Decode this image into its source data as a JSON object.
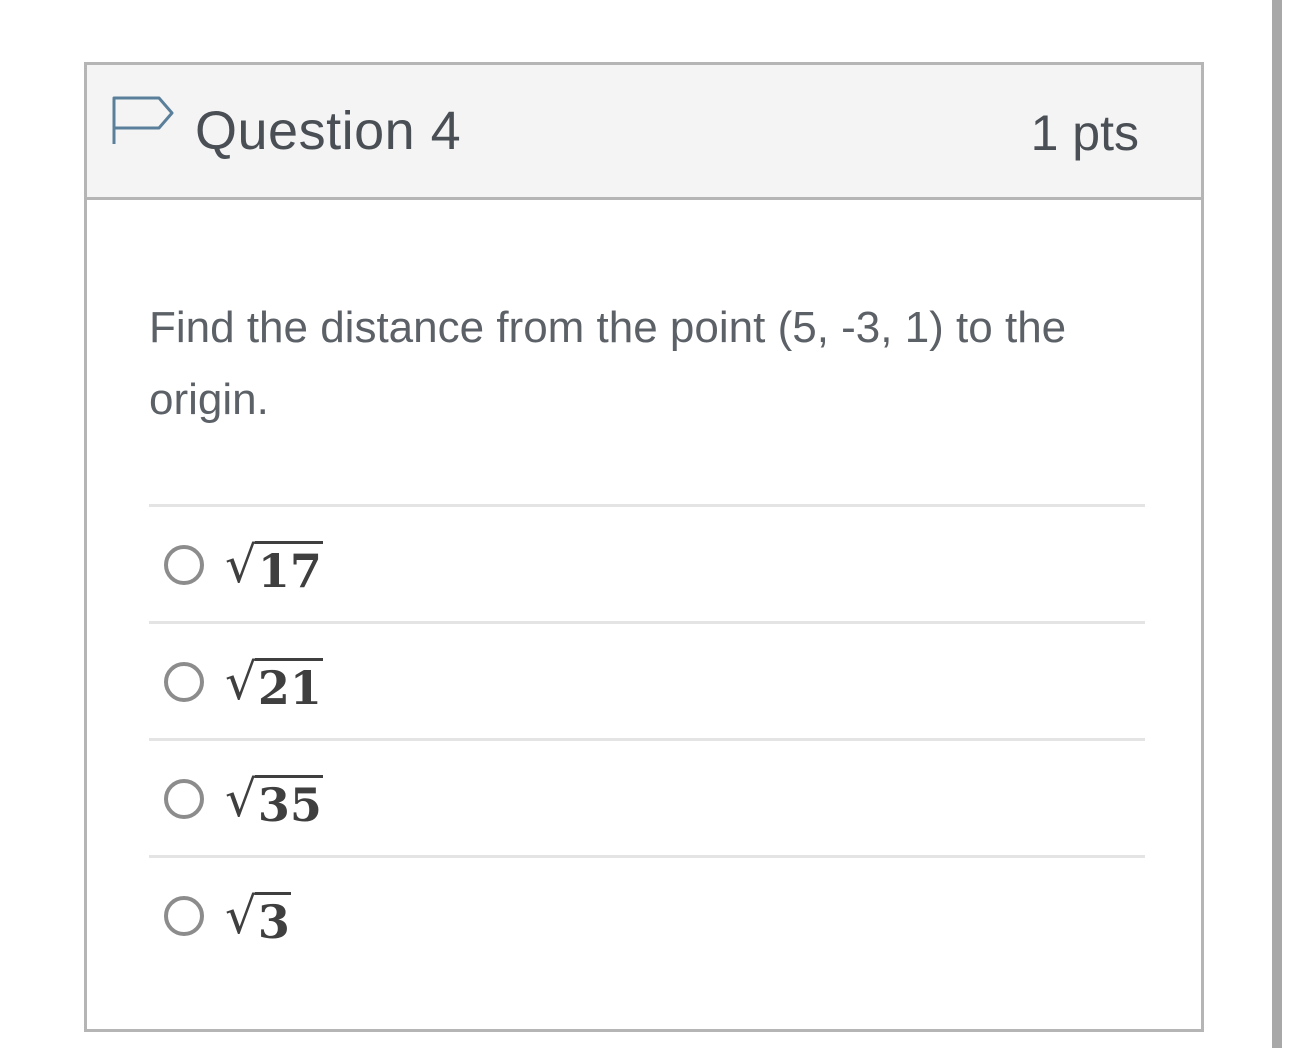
{
  "question": {
    "title": "Question 4",
    "points": "1 pts",
    "text": "Find the distance from the point (5, -3, 1) to the origin.",
    "flag_icon": "flag-outline-icon"
  },
  "answers": [
    {
      "symbol": "√",
      "radicand": "17"
    },
    {
      "symbol": "√",
      "radicand": "21"
    },
    {
      "symbol": "√",
      "radicand": "35"
    },
    {
      "symbol": "√",
      "radicand": "3"
    }
  ],
  "colors": {
    "header_bg": "#f4f4f4",
    "border": "#b5b5b5",
    "text": "#4a4f55",
    "flag": "#5a7f9a",
    "radio": "#8c8c8c"
  }
}
